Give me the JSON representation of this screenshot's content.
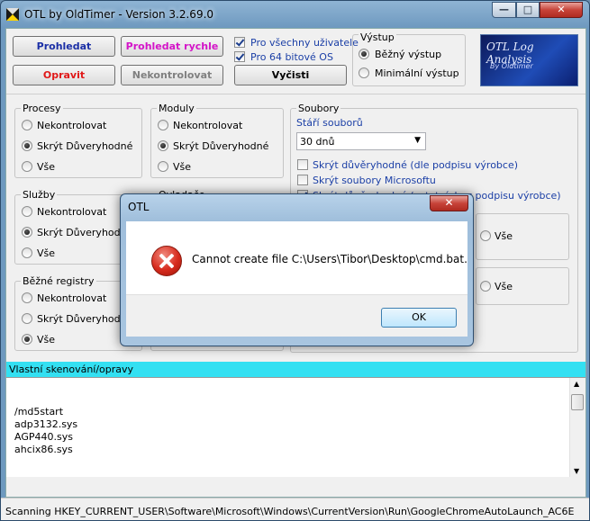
{
  "window": {
    "title": "OTL by OldTimer - Version 3.2.69.0"
  },
  "toolbar": {
    "scan_label": "Prohledat",
    "quick_scan_label": "Prohledat rychle",
    "fix_label": "Opravit",
    "unchecked_label": "Nekontrolovat",
    "clear_label": "Vyčisti",
    "all_users_label": "Pro všechny uživatele",
    "os64_label": "Pro 64 bitové OS",
    "colors": {
      "scan": "#1b2fa6",
      "quick_scan": "#d414c8",
      "fix": "#e01818",
      "unchecked": "#808080"
    }
  },
  "output": {
    "title": "Výstup",
    "normal": "Běžný výstup",
    "minimal": "Minimální výstup"
  },
  "logo": {
    "line1": "OTL Log Analysis",
    "line2": "By Oldtimer"
  },
  "groups": {
    "procesy": {
      "title": "Procesy"
    },
    "moduly": {
      "title": "Moduly"
    },
    "sluzby": {
      "title": "Služby"
    },
    "ovladace": {
      "title": "Ovladače"
    },
    "registry": {
      "title": "Běžné registry"
    },
    "soubory": {
      "title": "Soubory"
    }
  },
  "options": {
    "none": "Nekontrolovat",
    "hide_trusted": "Skrýt Důveryhodné",
    "all": "Vše"
  },
  "files": {
    "age_label": "Stáří souborů",
    "age_value": "30 dnů",
    "opt1": "Skrýt důvěryhodné (dle podpisu výrobce)",
    "opt2": "Skrýt soubory Microsoftu",
    "opt3": "Skrýt důvěryhodné (ostatní, bez podpisu výrobce)"
  },
  "custom": {
    "header": "Vlastní skenování/opravy",
    "lines": [
      "/md5start",
      "adp3132.sys",
      "AGP440.sys",
      "ahcix86.sys"
    ]
  },
  "status": {
    "text": "Scanning HKEY_CURRENT_USER\\Software\\Microsoft\\Windows\\CurrentVersion\\Run\\GoogleChromeAutoLaunch_AC6E"
  },
  "dialog": {
    "title": "OTL",
    "message": "Cannot create file C:\\Users\\Tibor\\Desktop\\cmd.bat.",
    "ok_label": "OK"
  }
}
